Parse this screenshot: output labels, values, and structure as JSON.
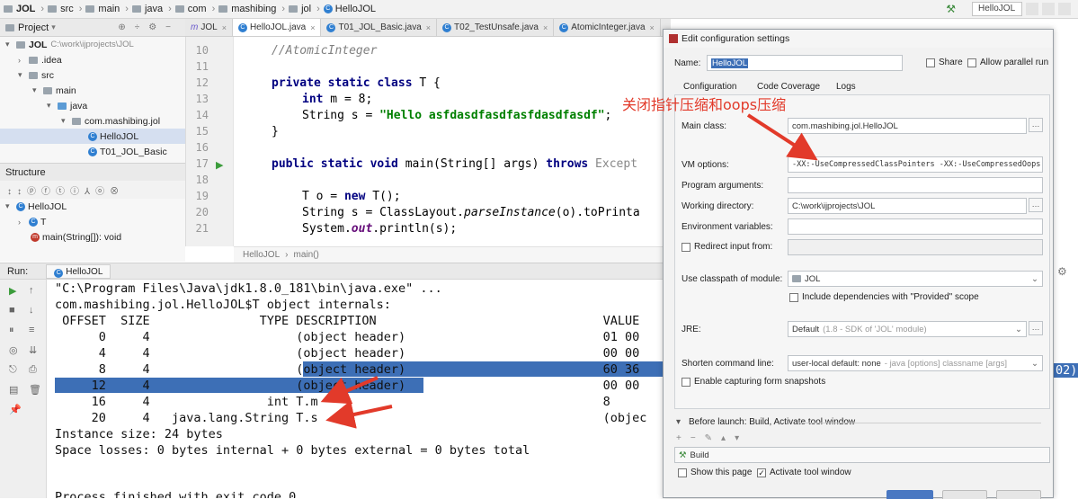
{
  "breadcrumb": {
    "items": [
      "JOL",
      "src",
      "main",
      "java",
      "com",
      "mashibing",
      "jol",
      "HelloJOL"
    ]
  },
  "toolbar": {
    "run_config": "HelloJOL"
  },
  "project": {
    "title": "Project"
  },
  "tree": {
    "items": [
      {
        "label": "JOL",
        "path": "C:\\work\\ijprojects\\JOL"
      },
      {
        "label": ".idea"
      },
      {
        "label": "src"
      },
      {
        "label": "main"
      },
      {
        "label": "java"
      },
      {
        "label": "com.mashibing.jol"
      },
      {
        "label": "HelloJOL"
      },
      {
        "label": "T01_JOL_Basic"
      }
    ]
  },
  "structure": {
    "title": "Structure",
    "items": [
      "HelloJOL",
      "T",
      "main(String[]): void"
    ]
  },
  "editor": {
    "tabs": [
      "JOL",
      "HelloJOL.java",
      "T01_JOL_Basic.java",
      "T02_TestUnsafe.java",
      "AtomicInteger.java"
    ],
    "line_numbers": [
      "10",
      "11",
      "12",
      "13",
      "14",
      "15",
      "16",
      "17",
      "18",
      "19",
      "20",
      "21"
    ],
    "lines": {
      "l10": "//AtomicInteger",
      "l12a": "private static class",
      "l12b": " T {",
      "l13a": "int",
      "l13b": " m = 8;",
      "l14a": "String s = ",
      "l14b": "\"Hello asfdasdfasdfasfdasdfasdf\"",
      "l14c": ";",
      "l15": "}",
      "l17a": "public static void",
      "l17b": " main(String[] args) ",
      "l17c": "throws",
      "l17d": " Except",
      "l19a": "T o = ",
      "l19b": "new",
      "l19c": " T();",
      "l20a": "String s = ClassLayout.",
      "l20b": "parseInstance",
      "l20c": "(o).toPrinta",
      "l21a": "System.",
      "l21b": "out",
      "l21c": ".println(s);"
    },
    "crumb": [
      "HelloJOL",
      "main()"
    ]
  },
  "run": {
    "label": "Run:",
    "tab": "HelloJOL"
  },
  "console": {
    "lines": [
      "\"C:\\Program Files\\Java\\jdk1.8.0_181\\bin\\java.exe\" ...",
      "com.mashibing.jol.HelloJOL$T object internals:",
      " OFFSET  SIZE               TYPE DESCRIPTION                               VALUE",
      "      0     4                    (object header)                           01 00",
      "      4     4                    (object header)                           00 00",
      "      8     4                    (object header)                           60 36",
      "     12     4                    (object header)                           00 00",
      "     16     4                int T.m                                       8",
      "     20     4   java.lang.String T.s                                       (objec",
      "Instance size: 24 bytes",
      "Space losses: 0 bytes internal + 0 bytes external = 0 bytes total",
      "Process finished with exit code 0"
    ],
    "cut_right": "02)"
  },
  "dialog": {
    "title": "Edit configuration settings",
    "name_label": "Name:",
    "name_value": "HelloJOL",
    "share_label": "Share",
    "parallel_label": "Allow parallel run",
    "tabs": [
      "Configuration",
      "Code Coverage",
      "Logs"
    ],
    "main_class_label": "Main class:",
    "main_class_value": "com.mashibing.jol.HelloJOL",
    "vm_label": "VM options:",
    "vm_value": "-XX:-UseCompressedClassPointers -XX:-UseCompressedOops",
    "prog_args_label": "Program arguments:",
    "workdir_label": "Working directory:",
    "workdir_value": "C:\\work\\ijprojects\\JOL",
    "env_label": "Environment variables:",
    "redirect_label": "Redirect input from:",
    "classpath_label": "Use classpath of module:",
    "classpath_value": "JOL",
    "include_label": "Include dependencies with \"Provided\" scope",
    "jre_label": "JRE:",
    "jre_value": "Default",
    "jre_hint": "(1.8 - SDK of 'JOL' module)",
    "shorten_label": "Shorten command line:",
    "shorten_value": "user-local default: none",
    "shorten_hint": "- java [options] classname [args]",
    "capture_label": "Enable capturing form snapshots",
    "before_launch_label": "Before launch: Build, Activate tool window",
    "build_label": "Build",
    "show_page_label": "Show this page",
    "activate_label": "Activate tool window"
  },
  "annotation": {
    "text": "关闭指针压缩和oops压缩",
    "color": "#e23a2a"
  }
}
